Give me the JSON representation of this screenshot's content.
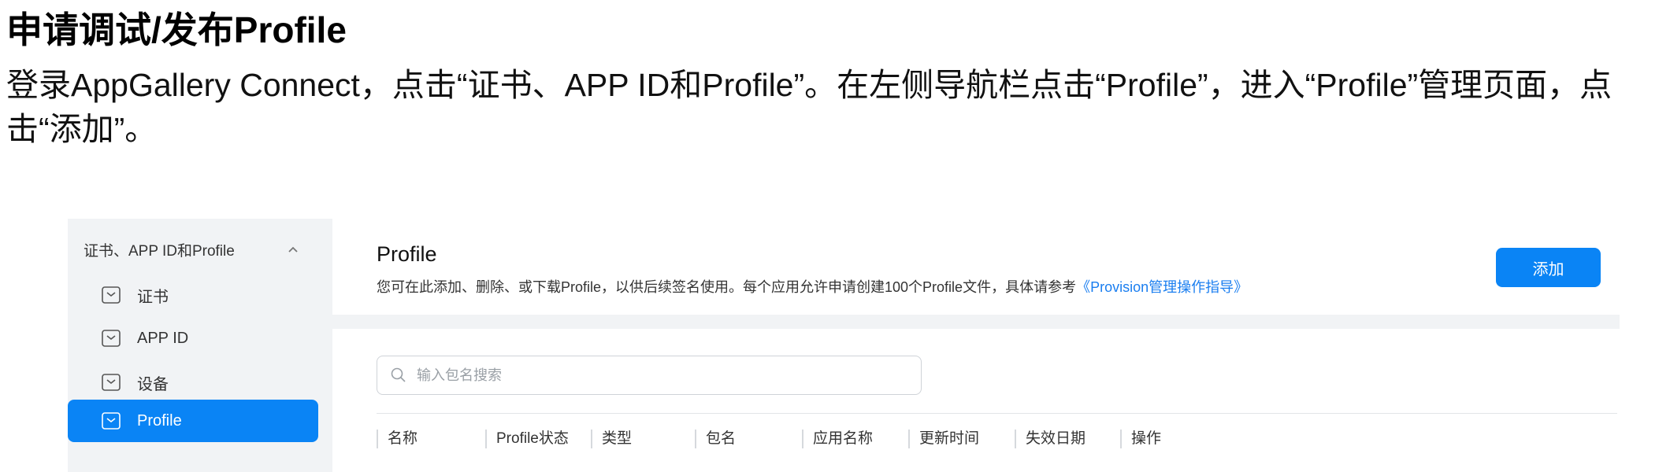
{
  "doc": {
    "title": "申请调试/发布Profile",
    "paragraph": "登录AppGallery Connect，点击“证书、APP ID和Profile”。在左侧导航栏点击“Profile”，进入“Profile”管理页面，点击“添加”。"
  },
  "sidebar": {
    "group_label": "证书、APP ID和Profile",
    "group_icon": "chevron-up-icon",
    "items": [
      {
        "label": "证书",
        "icon": "certificate-icon",
        "active": false
      },
      {
        "label": "APP ID",
        "icon": "app-id-icon",
        "active": false
      },
      {
        "label": "设备",
        "icon": "device-icon",
        "active": false
      },
      {
        "label": "Profile",
        "icon": "profile-icon",
        "active": true
      }
    ]
  },
  "header": {
    "title": "Profile",
    "description": "您可在此添加、删除、或下载Profile，以供后续签名使用。每个应用允许申请创建100个Profile文件，具体请参考",
    "link": "《Provision管理操作指导》",
    "add_label": "添加"
  },
  "search": {
    "placeholder": "输入包名搜索",
    "icon": "search-icon"
  },
  "table": {
    "columns": [
      "名称",
      "Profile状态",
      "类型",
      "包名",
      "应用名称",
      "更新时间",
      "失效日期",
      "操作"
    ]
  },
  "colors": {
    "accent": "#0a84f5",
    "link": "#1a7ef0",
    "app_bg": "#f1f3f5"
  }
}
